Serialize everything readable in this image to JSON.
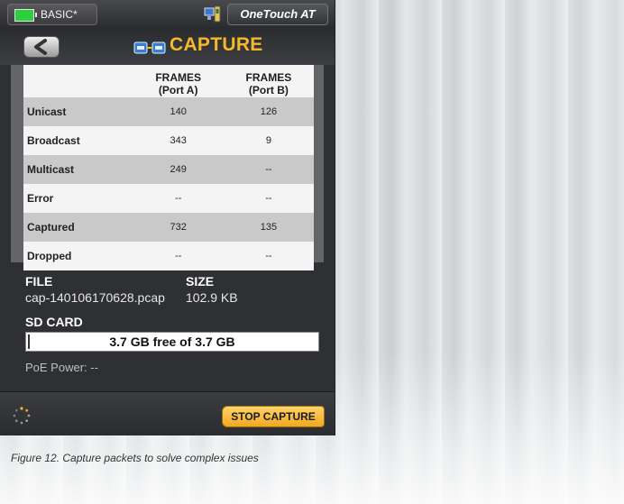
{
  "status_bar": {
    "profile_name": "BASIC*",
    "brand": "OneTouch AT"
  },
  "header": {
    "title": "CAPTURE"
  },
  "stats": {
    "columns": [
      "FRAMES\n(Port A)",
      "FRAMES\n(Port B)"
    ],
    "col_a_line1": "FRAMES",
    "col_a_line2": "(Port A)",
    "col_b_line1": "FRAMES",
    "col_b_line2": "(Port B)",
    "rows": [
      {
        "label": "Unicast",
        "port_a": "140",
        "port_b": "126"
      },
      {
        "label": "Broadcast",
        "port_a": "343",
        "port_b": "9"
      },
      {
        "label": "Multicast",
        "port_a": "249",
        "port_b": "--"
      },
      {
        "label": "Error",
        "port_a": "--",
        "port_b": "--"
      },
      {
        "label": "Captured",
        "port_a": "732",
        "port_b": "135"
      },
      {
        "label": "Dropped",
        "port_a": "--",
        "port_b": "--"
      }
    ]
  },
  "file": {
    "file_heading": "FILE",
    "size_heading": "SIZE",
    "file_name": "cap-140106170628.pcap",
    "file_size": "102.9 KB"
  },
  "sd_card": {
    "heading": "SD CARD",
    "status": "3.7 GB free of 3.7 GB",
    "used_fraction": 0.0
  },
  "poe": {
    "text": "PoE Power: --"
  },
  "footer": {
    "stop_label": "STOP CAPTURE"
  },
  "caption": "Figure 12. Capture packets to solve complex issues",
  "colors": {
    "accent": "#f5b82a",
    "battery": "#2ccf3c",
    "device_bg": "#2f3033"
  }
}
